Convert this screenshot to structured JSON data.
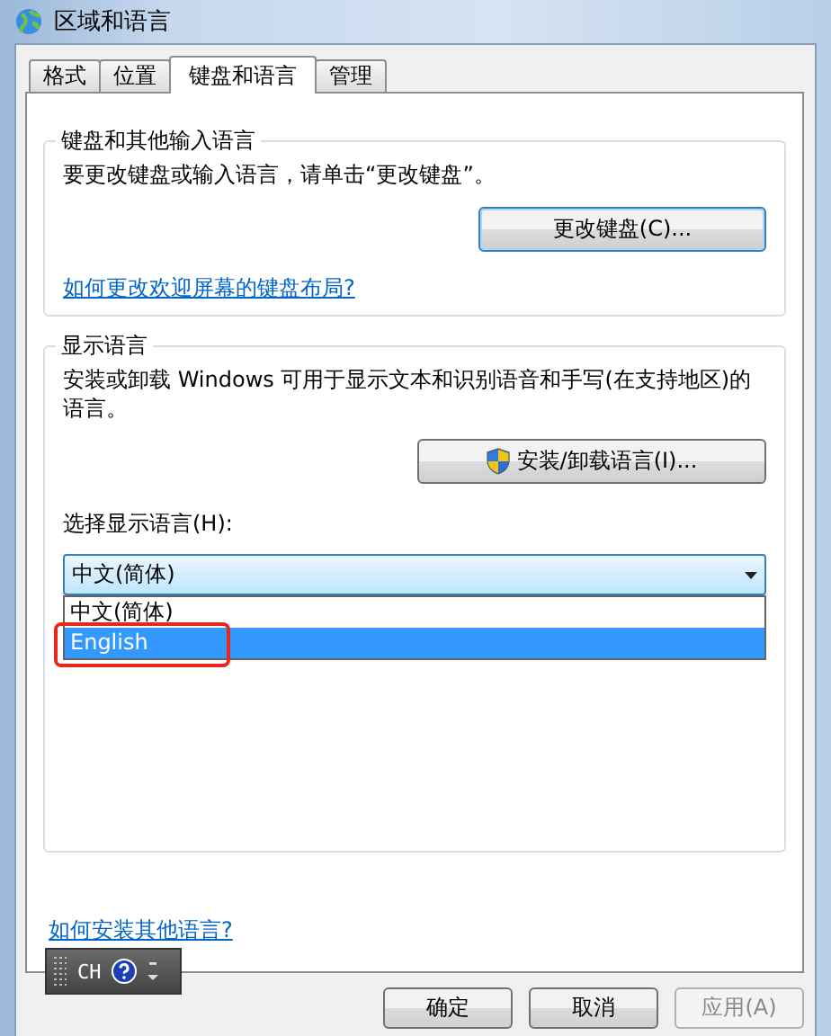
{
  "window": {
    "title": "区域和语言"
  },
  "tabs": [
    {
      "label": "格式",
      "selected": false
    },
    {
      "label": "位置",
      "selected": false
    },
    {
      "label": "键盘和语言",
      "selected": true
    },
    {
      "label": "管理",
      "selected": false
    }
  ],
  "keyboard_group": {
    "title": "键盘和其他输入语言",
    "description": "要更改键盘或输入语言，请单击“更改键盘”。",
    "button": "更改键盘(C)...",
    "link": "如何更改欢迎屏幕的键盘布局?"
  },
  "display_group": {
    "title": "显示语言",
    "description": "安装或卸载 Windows 可用于显示文本和识别语音和手写(在支持地区)的语言。",
    "button": "安装/卸载语言(I)...",
    "select_label": "选择显示语言(H):",
    "select_value": "中文(简体)",
    "options": [
      {
        "label": "中文(简体)",
        "selected": false,
        "annotated": false
      },
      {
        "label": "English",
        "selected": true,
        "annotated": true
      }
    ]
  },
  "link": "如何安装其他语言?",
  "language_bar": {
    "label": "CH"
  },
  "buttons": [
    {
      "label": "确定",
      "disabled": false
    },
    {
      "label": "取消",
      "disabled": false
    },
    {
      "label": "应用(A)",
      "disabled": true
    }
  ]
}
